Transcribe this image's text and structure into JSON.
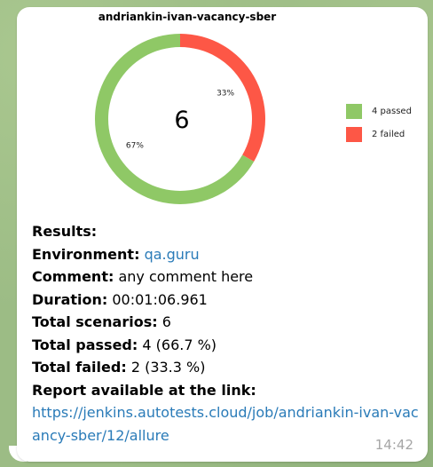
{
  "message": {
    "time": "14:42"
  },
  "chart_data": {
    "type": "pie",
    "title": "andriankin-ivan-vacancy-sber",
    "center_label": "6",
    "slices": [
      {
        "label": "passed",
        "value": 4,
        "percent_label": "67%",
        "color": "#8fc866"
      },
      {
        "label": "failed",
        "value": 2,
        "percent_label": "33%",
        "color": "#fd5746"
      }
    ],
    "legend": [
      "4 passed",
      "2 failed"
    ],
    "legend_placement": "right"
  },
  "report": {
    "results_label": "Results:",
    "environment_label": "Environment:",
    "environment_value": "qa.guru",
    "comment_label": "Comment:",
    "comment_value": "any comment here",
    "duration_label": "Duration:",
    "duration_value": "00:01:06.961",
    "total_label": "Total scenarios:",
    "total_value": "6",
    "passed_label": "Total passed:",
    "passed_value": "4 (66.7 %)",
    "failed_label": "Total failed:",
    "failed_value": "2 (33.3 %)",
    "link_label": "Report available at the link:",
    "link_url": "https://jenkins.autotests.cloud/job/andriankin-ivan-vacancy-sber/12/allure"
  }
}
